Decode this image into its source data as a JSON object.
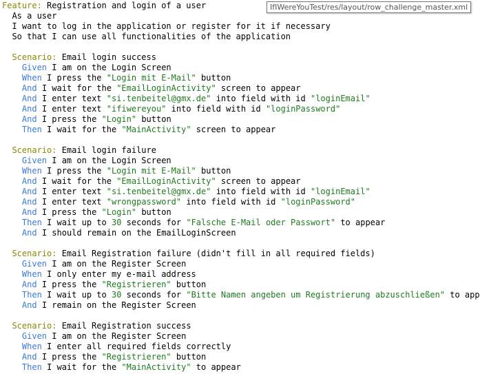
{
  "tooltip": "IfIWereYouTest/res/layout/row_challenge_master.xml",
  "colors": {
    "keyword": "#8a8a00",
    "step": "#3b7bd6",
    "string": "#1f7a1f",
    "text": "#000000"
  },
  "lines": [
    [
      [
        "kw",
        "Feature:"
      ],
      [
        "t",
        " Registration and login of a user"
      ]
    ],
    [
      [
        "t",
        "  As a user"
      ]
    ],
    [
      [
        "t",
        "  I want to log in the application or register for it if necessary"
      ]
    ],
    [
      [
        "t",
        "  So that I can use all functionalities of the application"
      ]
    ],
    [],
    [
      [
        "t",
        "  "
      ],
      [
        "kw",
        "Scenario:"
      ],
      [
        "t",
        " Email login success"
      ]
    ],
    [
      [
        "t",
        "    "
      ],
      [
        "step",
        "Given"
      ],
      [
        "t",
        " I am on the Login Screen"
      ]
    ],
    [
      [
        "t",
        "    "
      ],
      [
        "step",
        "When"
      ],
      [
        "t",
        " I press the "
      ],
      [
        "str",
        "\"Login mit E-Mail\""
      ],
      [
        "t",
        " button"
      ]
    ],
    [
      [
        "t",
        "    "
      ],
      [
        "step",
        "And"
      ],
      [
        "t",
        " I wait for the "
      ],
      [
        "str",
        "\"EmailLoginActivity\""
      ],
      [
        "t",
        " screen to appear"
      ]
    ],
    [
      [
        "t",
        "    "
      ],
      [
        "step",
        "And"
      ],
      [
        "t",
        " I enter text "
      ],
      [
        "str",
        "\"si.tenbeitel@gmx.de\""
      ],
      [
        "t",
        " into field with id "
      ],
      [
        "str",
        "\"loginEmail\""
      ]
    ],
    [
      [
        "t",
        "    "
      ],
      [
        "step",
        "And"
      ],
      [
        "t",
        " I enter text "
      ],
      [
        "str",
        "\"ifiwereyou\""
      ],
      [
        "t",
        " into field with id "
      ],
      [
        "str",
        "\"loginPassword\""
      ]
    ],
    [
      [
        "t",
        "    "
      ],
      [
        "step",
        "And"
      ],
      [
        "t",
        " I press the "
      ],
      [
        "str",
        "\"Login\""
      ],
      [
        "t",
        " button"
      ]
    ],
    [
      [
        "t",
        "    "
      ],
      [
        "step",
        "Then"
      ],
      [
        "t",
        " I wait for the "
      ],
      [
        "str",
        "\"MainActivity\""
      ],
      [
        "t",
        " screen to appear"
      ]
    ],
    [],
    [
      [
        "t",
        "  "
      ],
      [
        "kw",
        "Scenario:"
      ],
      [
        "t",
        " Email login failure"
      ]
    ],
    [
      [
        "t",
        "    "
      ],
      [
        "step",
        "Given"
      ],
      [
        "t",
        " I am on the Login Screen"
      ]
    ],
    [
      [
        "t",
        "    "
      ],
      [
        "step",
        "When"
      ],
      [
        "t",
        " I press the "
      ],
      [
        "str",
        "\"Login mit E-Mail\""
      ],
      [
        "t",
        " button"
      ]
    ],
    [
      [
        "t",
        "    "
      ],
      [
        "step",
        "And"
      ],
      [
        "t",
        " I wait for the "
      ],
      [
        "str",
        "\"EmailLoginActivity\""
      ],
      [
        "t",
        " screen to appear"
      ]
    ],
    [
      [
        "t",
        "    "
      ],
      [
        "step",
        "And"
      ],
      [
        "t",
        " I enter text "
      ],
      [
        "str",
        "\"si.tenbeitel@gmx.de\""
      ],
      [
        "t",
        " into field with id "
      ],
      [
        "str",
        "\"loginEmail\""
      ]
    ],
    [
      [
        "t",
        "    "
      ],
      [
        "step",
        "And"
      ],
      [
        "t",
        " I enter text "
      ],
      [
        "str",
        "\"wrongpassword\""
      ],
      [
        "t",
        " into field with id "
      ],
      [
        "str",
        "\"loginPassword\""
      ]
    ],
    [
      [
        "t",
        "    "
      ],
      [
        "step",
        "And"
      ],
      [
        "t",
        " I press the "
      ],
      [
        "str",
        "\"Login\""
      ],
      [
        "t",
        " button"
      ]
    ],
    [
      [
        "t",
        "    "
      ],
      [
        "step",
        "Then"
      ],
      [
        "t",
        " I wait up to "
      ],
      [
        "num",
        "30"
      ],
      [
        "t",
        " seconds for "
      ],
      [
        "str",
        "\"Falsche E-Mail oder Passwort\""
      ],
      [
        "t",
        " to appear"
      ]
    ],
    [
      [
        "t",
        "    "
      ],
      [
        "step",
        "And"
      ],
      [
        "t",
        " I should remain on the EmailLoginScreen"
      ]
    ],
    [],
    [
      [
        "t",
        "  "
      ],
      [
        "kw",
        "Scenario:"
      ],
      [
        "t",
        " Email Registration failure (didn't fill in all required fields)"
      ]
    ],
    [
      [
        "t",
        "    "
      ],
      [
        "step",
        "Given"
      ],
      [
        "t",
        " I am on the Register Screen"
      ]
    ],
    [
      [
        "t",
        "    "
      ],
      [
        "step",
        "When"
      ],
      [
        "t",
        " I only enter my e-mail address"
      ]
    ],
    [
      [
        "t",
        "    "
      ],
      [
        "step",
        "And"
      ],
      [
        "t",
        " I press the "
      ],
      [
        "str",
        "\"Registrieren\""
      ],
      [
        "t",
        " button"
      ]
    ],
    [
      [
        "t",
        "    "
      ],
      [
        "step",
        "Then"
      ],
      [
        "t",
        " I wait up to "
      ],
      [
        "num",
        "30"
      ],
      [
        "t",
        " seconds for "
      ],
      [
        "str",
        "\"Bitte Namen angeben um Registrierung abzuschließen\""
      ],
      [
        "t",
        " to appear"
      ]
    ],
    [
      [
        "t",
        "    "
      ],
      [
        "step",
        "And"
      ],
      [
        "t",
        " I remain on the Register Screen"
      ]
    ],
    [],
    [
      [
        "t",
        "  "
      ],
      [
        "kw",
        "Scenario:"
      ],
      [
        "t",
        " Email Registration success"
      ]
    ],
    [
      [
        "t",
        "    "
      ],
      [
        "step",
        "Given"
      ],
      [
        "t",
        " I am on the Register Screen"
      ]
    ],
    [
      [
        "t",
        "    "
      ],
      [
        "step",
        "When"
      ],
      [
        "t",
        " I enter all required fields correctly"
      ]
    ],
    [
      [
        "t",
        "    "
      ],
      [
        "step",
        "And"
      ],
      [
        "t",
        " I press the "
      ],
      [
        "str",
        "\"Registrieren\""
      ],
      [
        "t",
        " button"
      ]
    ],
    [
      [
        "t",
        "    "
      ],
      [
        "step",
        "Then"
      ],
      [
        "t",
        " I wait for the "
      ],
      [
        "str",
        "\"MainActivity\""
      ],
      [
        "t",
        " to appear"
      ]
    ]
  ]
}
